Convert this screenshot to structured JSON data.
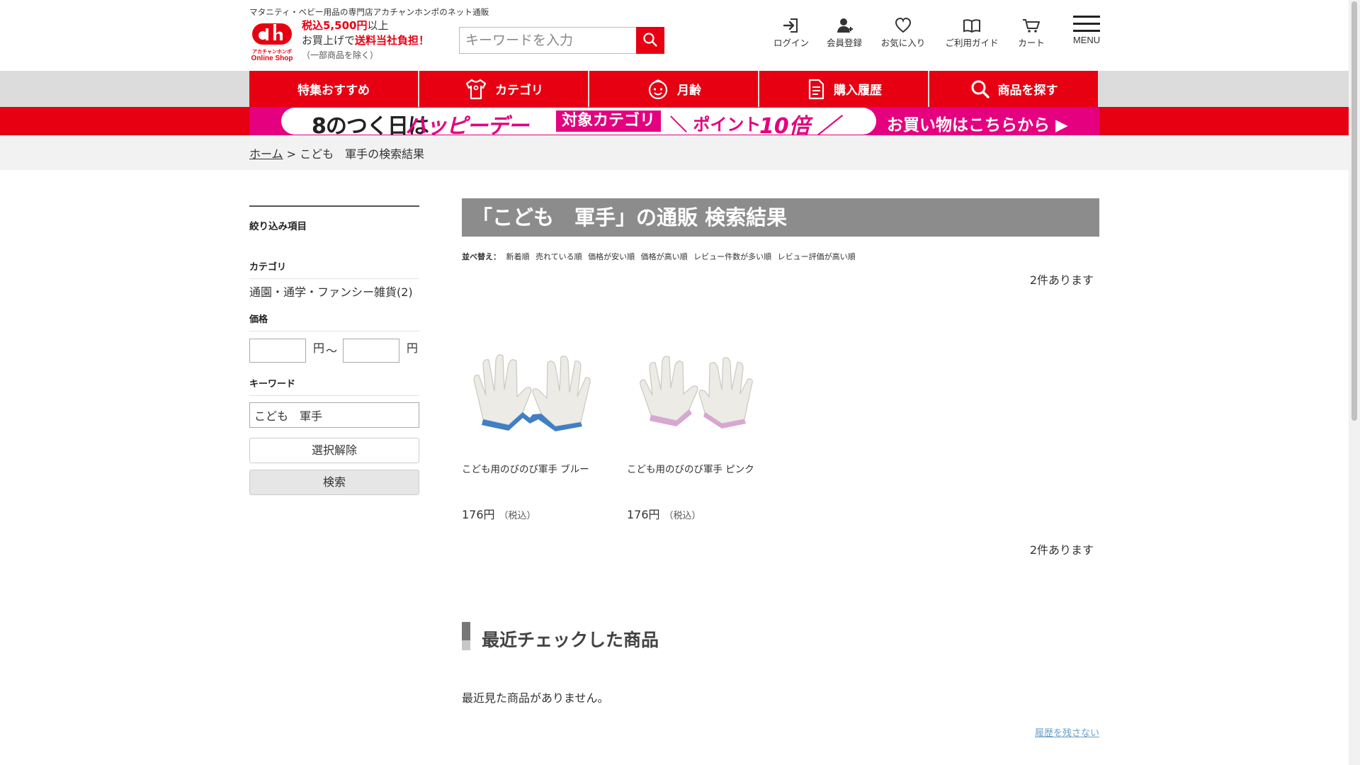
{
  "header": {
    "tagline": "マタニティ・ベビー用品の専門店アカチャンホンポのネット通販",
    "logo": {
      "mark": "ah",
      "sub": "アカチャンホンポ",
      "shop": "Online Shop"
    },
    "shipping": {
      "line1_red": "税込5,500円",
      "line1_suffix": "以上",
      "line2_prefix": "お買上げで",
      "line2_red": "送料当社負担！",
      "line3": "（一部商品を除く）"
    },
    "search": {
      "placeholder": "キーワードを入力",
      "value": ""
    },
    "nav": [
      {
        "label": "ログイン",
        "icon": "login-icon"
      },
      {
        "label": "会員登録",
        "icon": "user-plus-icon"
      },
      {
        "label": "お気に入り",
        "icon": "heart-icon"
      },
      {
        "label": "ご利用ガイド",
        "icon": "book-icon"
      },
      {
        "label": "カート",
        "icon": "cart-icon"
      }
    ],
    "menu_label": "MENU"
  },
  "gnav": [
    {
      "label": "特集おすすめ",
      "icon": ""
    },
    {
      "label": "カテゴリ",
      "icon": "baby-shirt-icon"
    },
    {
      "label": "月齢",
      "icon": "baby-face-icon"
    },
    {
      "label": "購入履歴",
      "icon": "document-icon"
    },
    {
      "label": "商品を探す",
      "icon": "search-icon"
    }
  ],
  "banner": {
    "p1": "8のつく日は",
    "p2": "ハッピーデー",
    "p3": "対象カテゴリ",
    "p4": "＼ ポイント",
    "p5": "10倍 ／",
    "p6": "お買い物はこちらから ▶"
  },
  "breadcrumb": {
    "home": "ホーム",
    "sep": " > ",
    "current": "こども　軍手の検索結果"
  },
  "sidebar": {
    "title": "絞り込み項目",
    "category_heading": "カテゴリ",
    "category_item": "通園・通学・ファンシー雑貨(2)",
    "price_heading": "価格",
    "yen": "円",
    "tilde": "〜",
    "keyword_heading": "キーワード",
    "keyword_value": "こども　軍手",
    "clear_label": "選択解除",
    "search_label": "検索"
  },
  "main": {
    "title": "「こども　軍手」の通販 検索結果",
    "sort_label": "並べ替え：",
    "sort_options": [
      "新着順",
      "売れている順",
      "価格が安い順",
      "価格が高い順",
      "レビュー件数が多い順",
      "レビュー評価が高い順"
    ],
    "count": "2件あります",
    "products": [
      {
        "name": "こども用のびのび軍手 ブルー",
        "price": "176円",
        "tax": "（税込）",
        "cuff_color": "#3f7fc6"
      },
      {
        "name": "こども用のびのび軍手 ピンク",
        "price": "176円",
        "tax": "（税込）",
        "cuff_color": "#d9a6d3"
      }
    ]
  },
  "recent": {
    "title": "最近チェックした商品",
    "none": "最近見た商品がありません。",
    "no_history": "履歴を残さない"
  },
  "colors": {
    "brand_red": "#e60012",
    "magenta": "#e4007f",
    "title_gray": "#8c8c8c"
  }
}
